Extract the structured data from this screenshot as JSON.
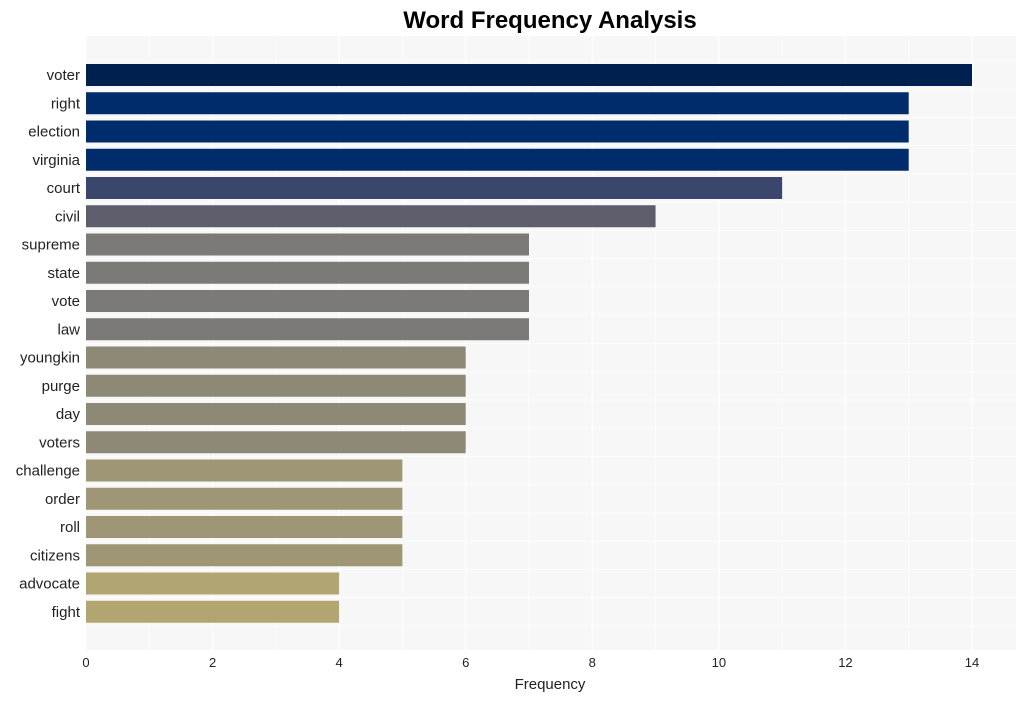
{
  "chart_data": {
    "type": "bar",
    "orientation": "horizontal",
    "title": "Word Frequency Analysis",
    "xlabel": "Frequency",
    "ylabel": "",
    "xlim": [
      0,
      14.7
    ],
    "xticks": [
      0,
      2,
      4,
      6,
      8,
      10,
      12,
      14
    ],
    "grid": true,
    "legend": "none",
    "categories": [
      "voter",
      "right",
      "election",
      "virginia",
      "court",
      "civil",
      "supreme",
      "state",
      "vote",
      "law",
      "youngkin",
      "purge",
      "day",
      "voters",
      "challenge",
      "order",
      "roll",
      "citizens",
      "advocate",
      "fight"
    ],
    "values": [
      14,
      13,
      13,
      13,
      11,
      9,
      7,
      7,
      7,
      7,
      6,
      6,
      6,
      6,
      5,
      5,
      5,
      5,
      4,
      4
    ],
    "colors": [
      "#00204f",
      "#002c6b",
      "#002c6b",
      "#002c6b",
      "#3a466c",
      "#5c5f6b",
      "#7b7a76",
      "#7b7a76",
      "#7b7a76",
      "#7b7a76",
      "#8e8877",
      "#8e8877",
      "#8e8877",
      "#8e8877",
      "#9f9676",
      "#9f9676",
      "#9f9676",
      "#9f9676",
      "#b1a572",
      "#b1a572"
    ]
  },
  "style": {
    "plot_background": "#f7f7f7",
    "grid_color": "#ffffff"
  }
}
